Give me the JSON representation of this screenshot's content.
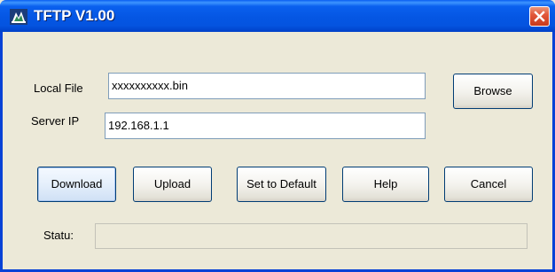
{
  "window": {
    "title": "TFTP V1.00"
  },
  "form": {
    "local_file_label": "Local File",
    "local_file_value": "xxxxxxxxxx.bin",
    "server_ip_label": "Server IP",
    "server_ip_value": "192.168.1.1",
    "status_label": "Statu:",
    "status_value": ""
  },
  "buttons": {
    "browse": "Browse",
    "download": "Download",
    "upload": "Upload",
    "set_default": "Set to Default",
    "help": "Help",
    "cancel": "Cancel"
  },
  "colors": {
    "titlebar": "#0554E0",
    "close_button": "#E2583B",
    "dialog_background": "#ECE9D8"
  },
  "icons": {
    "app": "tftp-app-icon",
    "close": "close-icon"
  }
}
